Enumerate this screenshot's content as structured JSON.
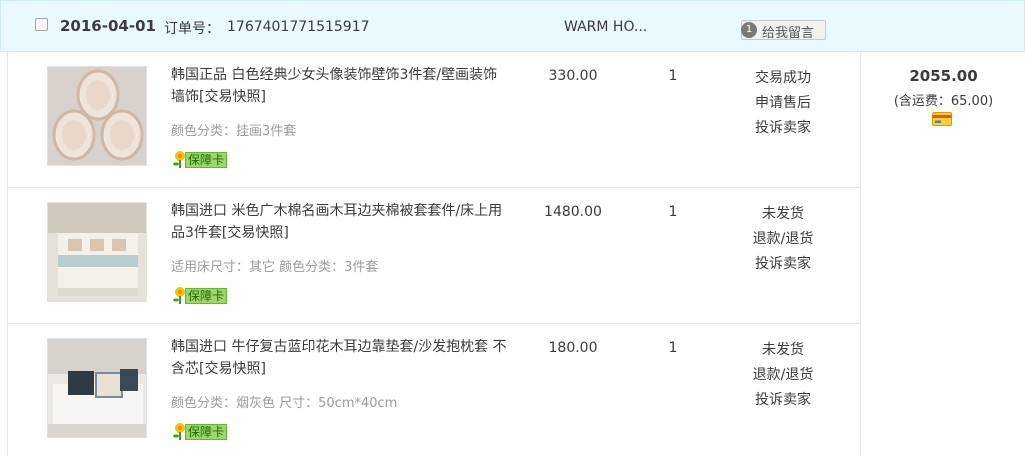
{
  "order": {
    "date": "2016-04-01",
    "order_no_label": "订单号：",
    "order_no": "1767401771515917",
    "shop_name": "WARM HO...",
    "message_button": "给我留言",
    "message_icon_text": "1",
    "total_amount": "2055.00",
    "shipping_text": "(含运费：65.00)"
  },
  "items": [
    {
      "title": "韩国正品 白色经典少女头像装饰壁饰3件套/壁画装饰墙饰[交易快照]",
      "attrs": "颜色分类：挂画3件套",
      "badge": "保障卡",
      "price": "330.00",
      "qty": "1",
      "status": [
        "交易成功",
        "申请售后",
        "投诉卖家"
      ]
    },
    {
      "title": "韩国进口 米色广木棉名画木耳边夹棉被套套件/床上用品3件套[交易快照]",
      "attrs": "适用床尺寸：其它  颜色分类：3件套",
      "badge": "保障卡",
      "price": "1480.00",
      "qty": "1",
      "status": [
        "未发货",
        "退款/退货",
        "投诉卖家"
      ]
    },
    {
      "title": "韩国进口 牛仔复古蓝印花木耳边靠垫套/沙发抱枕套 不含芯[交易快照]",
      "attrs": "颜色分类：烟灰色  尺寸：50cm*40cm",
      "badge": "保障卡",
      "price": "180.00",
      "qty": "1",
      "status": [
        "未发货",
        "退款/退货",
        "投诉卖家"
      ]
    }
  ],
  "colors": {
    "header_bg": "#eaf8ff",
    "border": "#dfe8ef",
    "badge_bg": "#9dd76b",
    "badge_text": "#1e6b00"
  }
}
